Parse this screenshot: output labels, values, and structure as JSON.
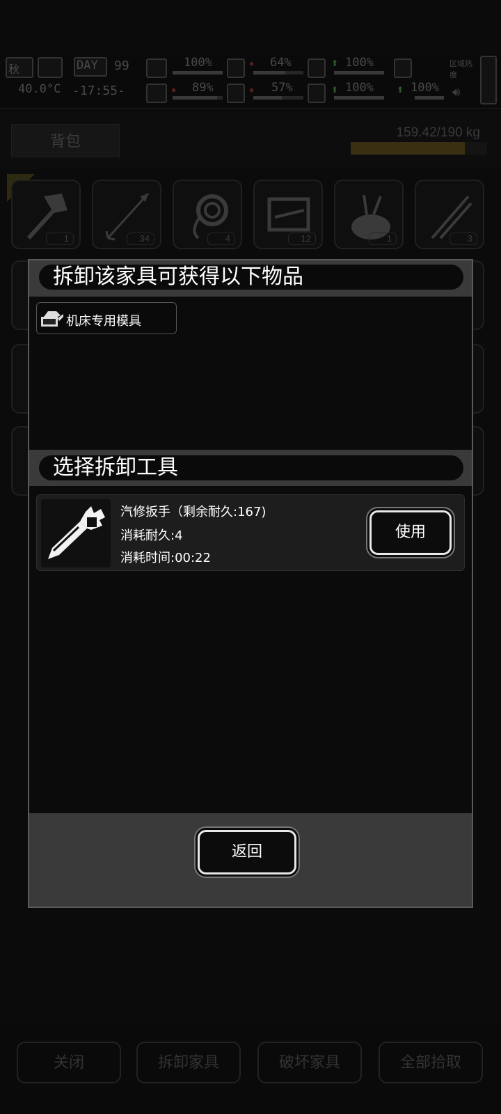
{
  "hud": {
    "season": "秋",
    "temperature": "40.0°C",
    "day_label": "DAY",
    "day_value": "99",
    "clock": "-17:55-",
    "stats": [
      {
        "icon": "medkit-icon",
        "value": "100%"
      },
      {
        "icon": "stomach-icon",
        "value": "64%"
      },
      {
        "icon": "bladder-icon",
        "value": "100%"
      },
      {
        "icon": "brain-icon",
        "value": "89%"
      },
      {
        "icon": "water-drop-icon",
        "value": "57%"
      },
      {
        "icon": "heart-icon",
        "value": "100%"
      },
      {
        "icon": "stamina-icon",
        "value": "100%"
      }
    ],
    "zone_label": "区域热度"
  },
  "backpack": {
    "tab_label": "背包",
    "weight": "159.42/190 kg",
    "weight_fraction": 0.839
  },
  "inventory": [
    {
      "icon": "axe-icon",
      "count": "1"
    },
    {
      "icon": "arrow-icon",
      "count": "34"
    },
    {
      "icon": "rope-icon",
      "count": "4"
    },
    {
      "icon": "toolbox-icon",
      "count": "12"
    },
    {
      "icon": "tool-bag-icon",
      "count": "1"
    },
    {
      "icon": "pliers-icon",
      "count": "3"
    }
  ],
  "modal": {
    "obtain_title": "拆卸该家具可获得以下物品",
    "obtained_items": [
      {
        "icon": "machine-mold-icon",
        "label": "机床专用模具"
      }
    ],
    "tool_title": "选择拆卸工具",
    "tools": [
      {
        "icon": "wrench-icon",
        "name": "汽修扳手（剩余耐久:167)",
        "cost": "消耗耐久:4",
        "time": "消耗时间:00:22",
        "use_label": "使用"
      }
    ],
    "back_label": "返回"
  },
  "footer": {
    "close_label": "关闭",
    "dismantle_label": "拆卸家具",
    "destroy_label": "破坏家具",
    "pickup_all_label": "全部拾取"
  }
}
